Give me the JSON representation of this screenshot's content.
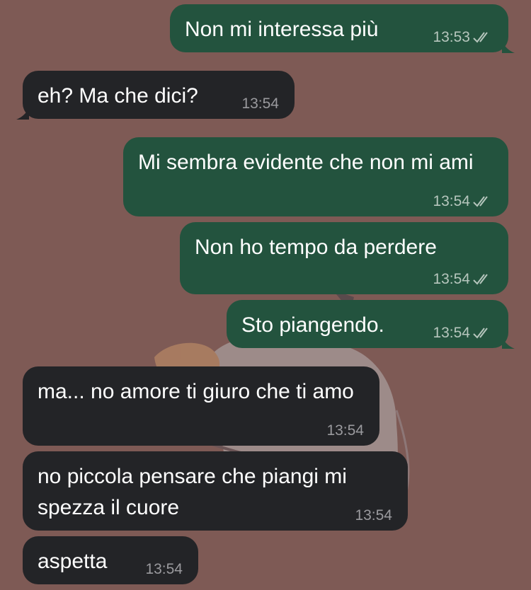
{
  "chat": {
    "messages": [
      {
        "direction": "out",
        "text": "Non mi interessa più",
        "time": "13:53",
        "read_icon": "double-check-icon"
      },
      {
        "direction": "in",
        "text": "eh? Ma che dici?",
        "time": "13:54"
      },
      {
        "direction": "out",
        "text": "Mi sembra evidente che non mi ami",
        "time": "13:54",
        "read_icon": "double-check-icon"
      },
      {
        "direction": "out",
        "text": "Non ho tempo da perdere",
        "time": "13:54",
        "read_icon": "double-check-icon"
      },
      {
        "direction": "out",
        "text": "Sto piangendo.",
        "time": "13:54",
        "read_icon": "double-check-icon"
      },
      {
        "direction": "in",
        "text": "ma... no amore ti giuro che ti amo",
        "time": "13:54"
      },
      {
        "direction": "in",
        "text": "no piccola pensare che piangi mi spezza il cuore",
        "time": "13:54"
      },
      {
        "direction": "in",
        "text": "aspetta",
        "time": "13:54"
      }
    ]
  },
  "colors": {
    "background": "#7e5a55",
    "outgoing_bubble": "#23533e",
    "incoming_bubble": "#232427",
    "text": "#ffffff"
  }
}
